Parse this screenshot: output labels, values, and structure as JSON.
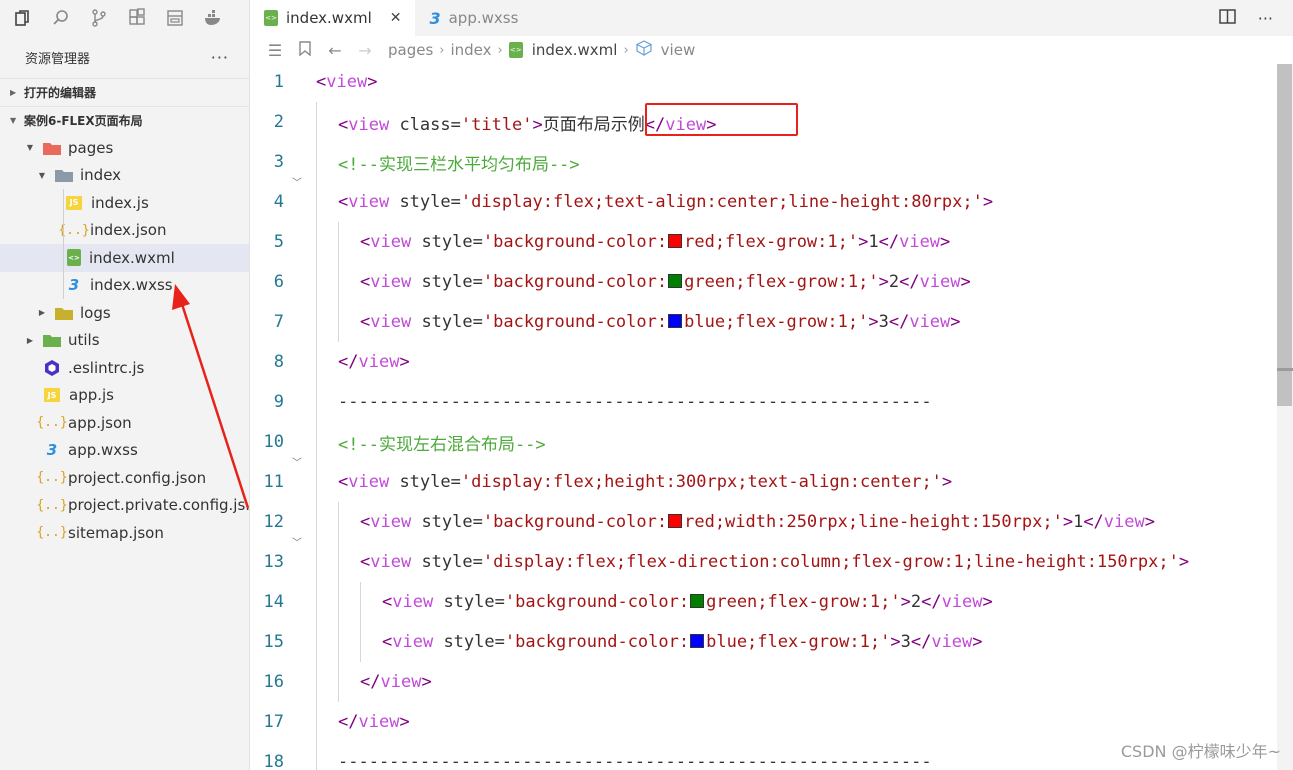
{
  "activity_bar": {
    "icons": [
      "files-icon",
      "search-icon",
      "source-control-icon",
      "extensions-icon",
      "devtools-icon",
      "docker-icon"
    ]
  },
  "explorer": {
    "title": "资源管理器",
    "more": "···",
    "open_editors_label": "打开的编辑器",
    "project_label": "案例6-FLEX页面布局",
    "tree": [
      {
        "label": "pages",
        "type": "folder-pages",
        "expanded": true
      },
      {
        "label": "index",
        "type": "folder",
        "expanded": true
      },
      {
        "label": "index.js",
        "type": "js"
      },
      {
        "label": "index.json",
        "type": "json"
      },
      {
        "label": "index.wxml",
        "type": "wxml",
        "selected": true
      },
      {
        "label": "index.wxss",
        "type": "wxss"
      },
      {
        "label": "logs",
        "type": "folder-logs",
        "expanded": false
      },
      {
        "label": "utils",
        "type": "folder-utils",
        "expanded": false
      },
      {
        "label": ".eslintrc.js",
        "type": "eslint"
      },
      {
        "label": "app.js",
        "type": "js"
      },
      {
        "label": "app.json",
        "type": "json"
      },
      {
        "label": "app.wxss",
        "type": "wxss"
      },
      {
        "label": "project.config.json",
        "type": "json"
      },
      {
        "label": "project.private.config.js...",
        "type": "json"
      },
      {
        "label": "sitemap.json",
        "type": "json"
      }
    ]
  },
  "tabs": {
    "active": {
      "label": "index.wxml",
      "close": "✕"
    },
    "inactive": {
      "label": "app.wxss"
    }
  },
  "breadcrumb": {
    "parts": [
      "pages",
      "index"
    ],
    "file": "index.wxml",
    "symbol": "view"
  },
  "code": {
    "lines": [
      "<view>",
      "  <view class='title'>页面布局示例</view>",
      "  <!--实现三栏水平均匀布局-->",
      "  <view style='display:flex;text-align:center;line-height:80rpx;'>",
      "    <view style='background-color: red;flex-grow:1;'>1</view>",
      "    <view style='background-color: green;flex-grow:1;'>2</view>",
      "    <view style='background-color: blue;flex-grow:1;'>3</view>",
      "  </view>",
      "  ----------------------------------------------------------",
      "  <!--实现左右混合布局-->",
      "  <view style='display:flex;height:300rpx;text-align:center;'>",
      "    <view style='background-color: red;width:250rpx;line-height:150rpx;'>1</view>",
      "    <view style='display:flex;flex-direction:column;flex-grow:1;line-height:150rpx;'>",
      "      <view style='background-color: green;flex-grow:1;'>2</view>",
      "      <view style='background-color: blue;flex-grow:1;'>3</view>",
      "    </view>",
      "  </view>",
      "  ----------------------------------------------------------"
    ],
    "swatch_colors": {
      "red": "#ff0000",
      "green": "#008000",
      "blue": "#0000ff"
    }
  },
  "colors": {
    "highlight_box": "#e8221b",
    "annotation_arrow": "#e8221b"
  },
  "watermark": "CSDN @柠檬味少年~"
}
